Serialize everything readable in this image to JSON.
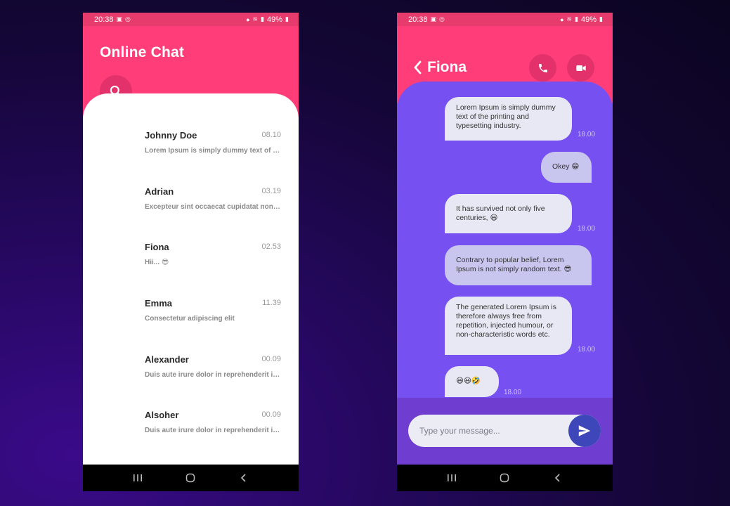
{
  "left_phone": {
    "status": {
      "time": "20:38",
      "battery": "49%"
    },
    "header": {
      "title": "Online Chat"
    },
    "chats": [
      {
        "name": "Johnny Doe",
        "time": "08.10",
        "preview": "Lorem Ipsum is simply dummy text of the printing"
      },
      {
        "name": "Adrian",
        "time": "03.19",
        "preview": "Excepteur sint occaecat cupidatat non proident"
      },
      {
        "name": "Fiona",
        "time": "02.53",
        "preview": "Hii... 😎"
      },
      {
        "name": "Emma",
        "time": "11.39",
        "preview": "Consectetur adipiscing elit"
      },
      {
        "name": "Alexander",
        "time": "00.09",
        "preview": "Duis aute irure dolor in reprehenderit in voluptate"
      },
      {
        "name": "Alsoher",
        "time": "00.09",
        "preview": "Duis aute irure dolor in reprehenderit in voluptate"
      }
    ]
  },
  "right_phone": {
    "status": {
      "time": "20:38",
      "battery": "49%"
    },
    "header": {
      "contact_name": "Fiona"
    },
    "messages": [
      {
        "text": "Lorem Ipsum is simply dummy text of the printing and typesetting industry.",
        "time": "18.00"
      },
      {
        "text": "Okey 😁"
      },
      {
        "text": "It has survived not only five centuries, 😆",
        "time": "18.00"
      },
      {
        "text": "Contrary to popular belief, Lorem Ipsum is not simply random text. 😎"
      },
      {
        "text": "The generated Lorem Ipsum is therefore always free from repetition, injected humour, or non-characteristic words etc.",
        "time": "18.00"
      },
      {
        "text": "😆😆🤣",
        "time": "18.00"
      }
    ],
    "composer": {
      "placeholder": "Type your message..."
    }
  },
  "colors": {
    "header_pink": "#fe3d79",
    "chat_purple": "#7650f1",
    "send_blue": "#3d47ba"
  }
}
